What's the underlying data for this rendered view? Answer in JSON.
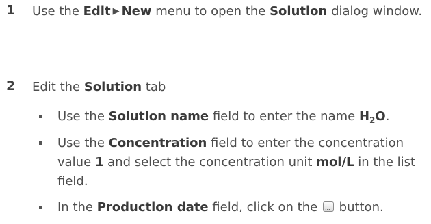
{
  "step1": {
    "number": "1",
    "t1": "Use the ",
    "b1": "Edit",
    "arrow": "▶",
    "b2": "New",
    "t2": " menu to open the ",
    "b3": "Solution",
    "t3": " dialog window."
  },
  "step2": {
    "number": "2",
    "t1": "Edit the ",
    "b1": "Solution",
    "t2": " tab",
    "bullets": [
      {
        "t1": "Use the ",
        "b1": "Solution name",
        "t2": " field to enter the name ",
        "formula_base": "H",
        "formula_sub": "2",
        "formula_end": "O",
        "t3": "."
      },
      {
        "t1": "Use the ",
        "b1": "Concentration",
        "t2": " field to enter the concentration value ",
        "b2": "1",
        "t3": " and select the concentration unit ",
        "b3": "mol/L",
        "t4": " in the list field."
      },
      {
        "t1": "In the ",
        "b1": "Production date",
        "t2": " field, click on the ",
        "icon": "ellipsis-button-icon",
        "t3": " button."
      }
    ]
  }
}
